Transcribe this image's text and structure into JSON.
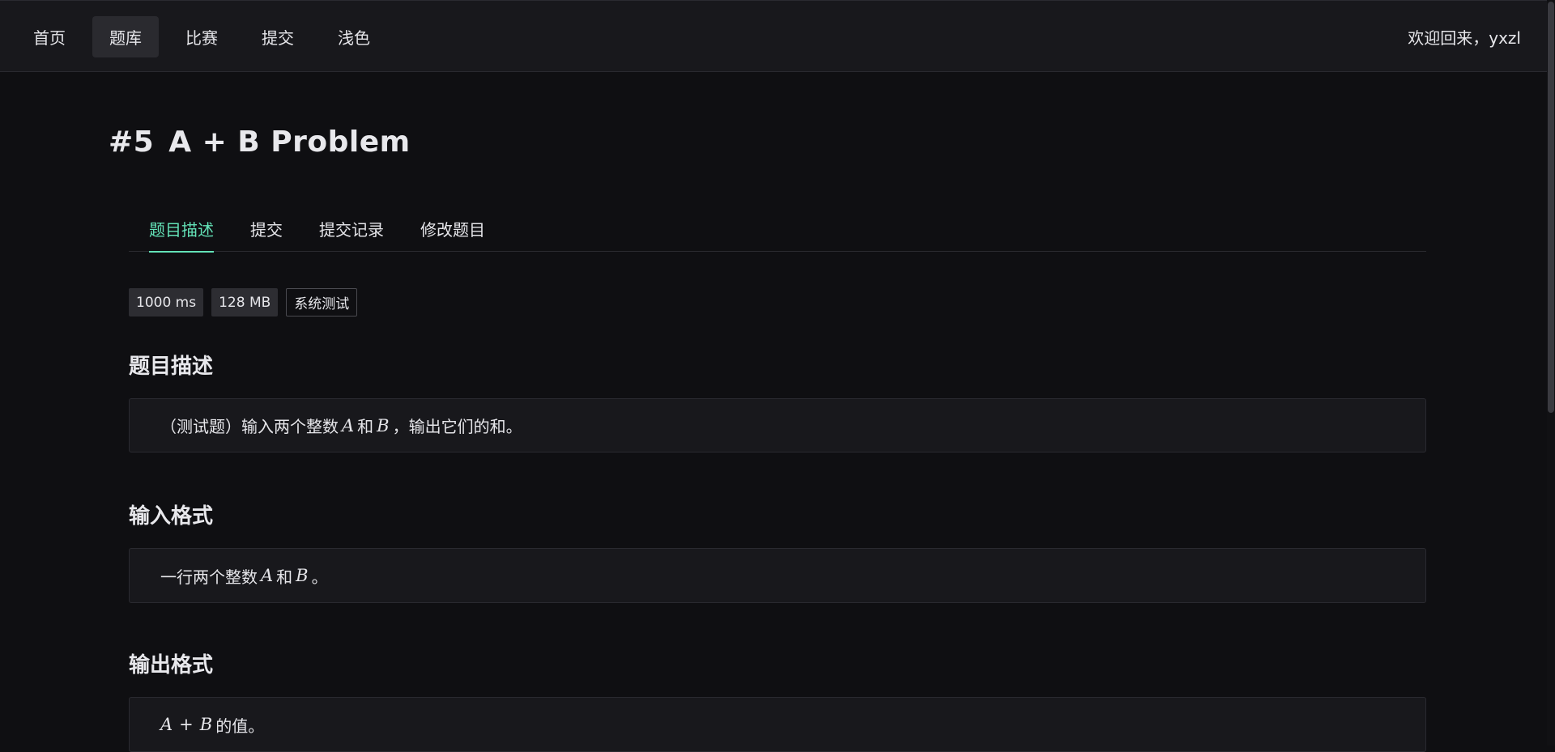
{
  "nav": {
    "items": [
      {
        "label": "首页"
      },
      {
        "label": "题库"
      },
      {
        "label": "比赛"
      },
      {
        "label": "提交"
      },
      {
        "label": "浅色"
      }
    ],
    "welcome": "欢迎回来，yxzl"
  },
  "problem": {
    "id": "#5",
    "title": "A + B Problem"
  },
  "tabs": [
    {
      "label": "题目描述"
    },
    {
      "label": "提交"
    },
    {
      "label": "提交记录"
    },
    {
      "label": "修改题目"
    }
  ],
  "tags": {
    "time_limit": "1000 ms",
    "memory_limit": "128 MB",
    "category": "系统测试"
  },
  "sections": {
    "description": {
      "title": "题目描述",
      "text_before": "（测试题）输入两个整数",
      "var_a": "A",
      "conj": "和",
      "var_b": "B",
      "text_after": "，输出它们的和。"
    },
    "input": {
      "title": "输入格式",
      "text_before": "一行两个整数",
      "var_a": "A",
      "conj": "和",
      "var_b": "B",
      "text_after": "。"
    },
    "output": {
      "title": "输出格式",
      "var_a": "A",
      "op": "+",
      "var_b": "B",
      "text_after": "的值。"
    }
  },
  "colors": {
    "accent": "#63e2b7",
    "background": "#0f0f12",
    "panel": "#18181c"
  }
}
